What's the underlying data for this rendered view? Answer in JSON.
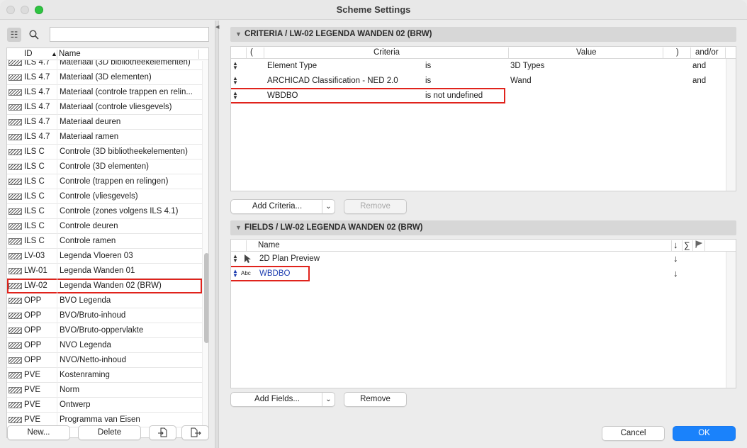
{
  "window": {
    "title": "Scheme Settings"
  },
  "left": {
    "search_placeholder": "",
    "header": {
      "id": "ID",
      "name": "Name"
    },
    "rows": [
      {
        "id": "ILS 4.7",
        "name": "Materiaal (3D bibliotheekelementen)"
      },
      {
        "id": "ILS 4.7",
        "name": "Materiaal (3D elementen)"
      },
      {
        "id": "ILS 4.7",
        "name": "Materiaal (controle trappen en relin..."
      },
      {
        "id": "ILS 4.7",
        "name": "Materiaal (controle vliesgevels)"
      },
      {
        "id": "ILS 4.7",
        "name": "Materiaal deuren"
      },
      {
        "id": "ILS 4.7",
        "name": "Materiaal ramen"
      },
      {
        "id": "ILS C",
        "name": "Controle (3D bibliotheekelementen)"
      },
      {
        "id": "ILS C",
        "name": "Controle (3D elementen)"
      },
      {
        "id": "ILS C",
        "name": "Controle (trappen en relingen)"
      },
      {
        "id": "ILS C",
        "name": "Controle (vliesgevels)"
      },
      {
        "id": "ILS C",
        "name": "Controle (zones volgens ILS 4.1)"
      },
      {
        "id": "ILS C",
        "name": "Controle deuren"
      },
      {
        "id": "ILS C",
        "name": "Controle ramen"
      },
      {
        "id": "LV-03",
        "name": "Legenda Vloeren 03"
      },
      {
        "id": "LW-01",
        "name": "Legenda Wanden 01"
      },
      {
        "id": "LW-02",
        "name": "Legenda Wanden 02 (BRW)"
      },
      {
        "id": "OPP",
        "name": "BVO Legenda"
      },
      {
        "id": "OPP",
        "name": "BVO/Bruto-inhoud"
      },
      {
        "id": "OPP",
        "name": "BVO/Bruto-oppervlakte"
      },
      {
        "id": "OPP",
        "name": "NVO Legenda"
      },
      {
        "id": "OPP",
        "name": "NVO/Netto-inhoud"
      },
      {
        "id": "PVE",
        "name": "Kostenraming"
      },
      {
        "id": "PVE",
        "name": "Norm"
      },
      {
        "id": "PVE",
        "name": "Ontwerp"
      },
      {
        "id": "PVE",
        "name": "Programma van Eisen"
      }
    ],
    "buttons": {
      "new": "New...",
      "delete": "Delete"
    }
  },
  "criteria": {
    "title": "CRITERIA / LW-02 LEGENDA WANDEN 02 (BRW)",
    "headers": {
      "open": "(",
      "criteria": "Criteria",
      "value": "Value",
      "close": ")",
      "andor": "and/or"
    },
    "rows": [
      {
        "element": "Element Type",
        "op": "is",
        "value": "3D Types",
        "andor": "and"
      },
      {
        "element": "ARCHICAD Classification - NED 2.0",
        "op": "is",
        "value": "Wand",
        "andor": "and"
      },
      {
        "element": "WBDBO",
        "op": "is not undefined",
        "value": "",
        "andor": ""
      }
    ],
    "add_label": "Add Criteria...",
    "remove_label": "Remove"
  },
  "fields": {
    "title": "FIELDS / LW-02 LEGENDA WANDEN 02 (BRW)",
    "headers": {
      "name": "Name",
      "sort": "↓",
      "sum": "∑"
    },
    "rows": [
      {
        "icon_text": "",
        "name": "2D Plan Preview",
        "sort": "↓"
      },
      {
        "icon_text": "Abc",
        "name": "WBDBO",
        "sort": "↓"
      }
    ],
    "add_label": "Add Fields...",
    "remove_label": "Remove"
  },
  "footer": {
    "cancel": "Cancel",
    "ok": "OK"
  }
}
